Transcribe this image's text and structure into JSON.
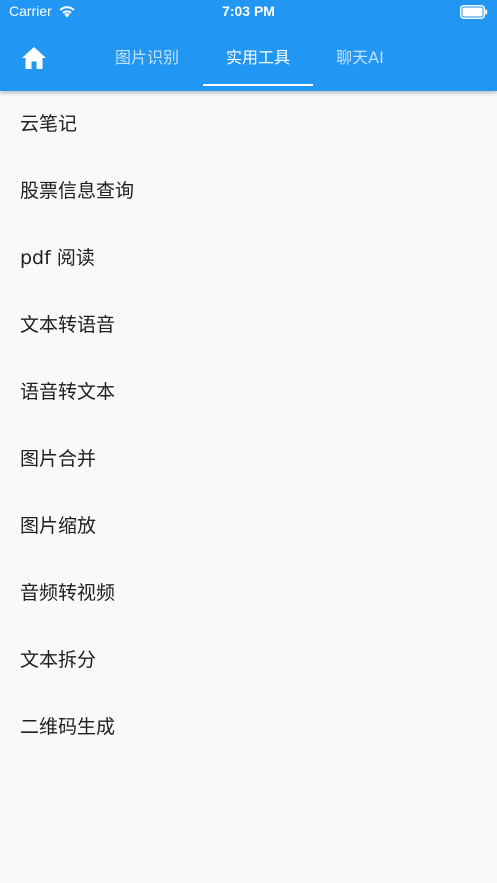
{
  "status_bar": {
    "carrier": "Carrier",
    "time": "7:03 PM",
    "wifi_icon": "wifi-icon",
    "battery_icon": "battery-icon"
  },
  "app_bar": {
    "background_color": "#2196f3",
    "home_icon": "home-icon",
    "tabs": [
      {
        "label": "图片识别",
        "active": false
      },
      {
        "label": "实用工具",
        "active": true
      },
      {
        "label": "聊天AI",
        "active": false
      }
    ]
  },
  "tools": [
    "云笔记",
    "股票信息查询",
    "pdf 阅读",
    "文本转语音",
    "语音转文本",
    "图片合并",
    "图片缩放",
    "音频转视频",
    "文本拆分",
    "二维码生成"
  ]
}
